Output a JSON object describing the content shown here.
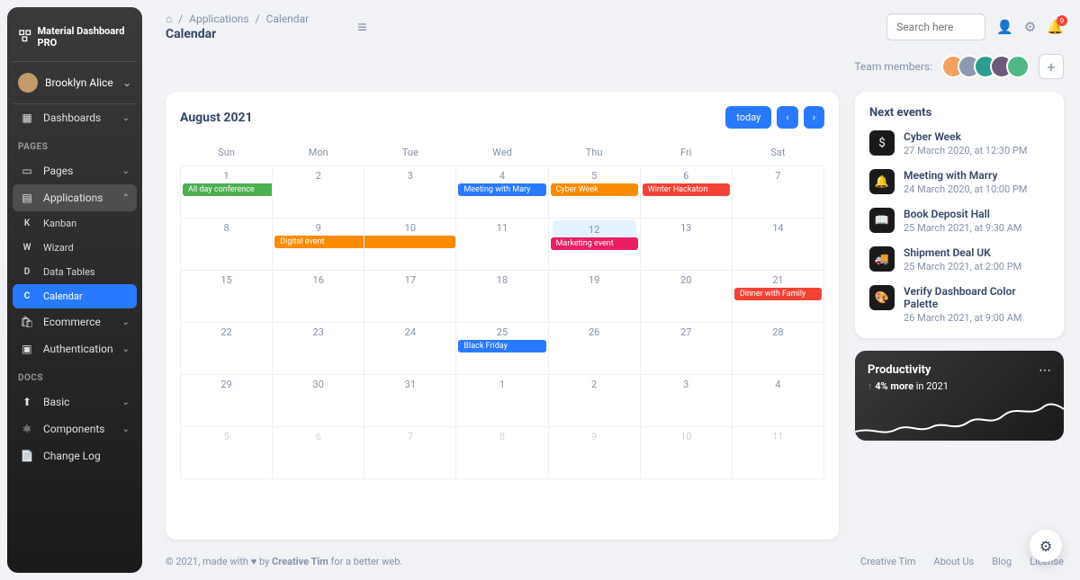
{
  "brand": "Material Dashboard PRO",
  "user": {
    "name": "Brooklyn Alice"
  },
  "sidebar": {
    "dashboards": "Dashboards",
    "section_pages": "PAGES",
    "pages": "Pages",
    "applications": "Applications",
    "sub": {
      "kanban": {
        "letter": "K",
        "label": "Kanban"
      },
      "wizard": {
        "letter": "W",
        "label": "Wizard"
      },
      "datatables": {
        "letter": "D",
        "label": "Data Tables"
      },
      "calendar": {
        "letter": "C",
        "label": "Calendar"
      }
    },
    "ecommerce": "Ecommerce",
    "authentication": "Authentication",
    "section_docs": "DOCS",
    "basic": "Basic",
    "components": "Components",
    "changelog": "Change Log"
  },
  "breadcrumb": {
    "home_icon": "⌂",
    "l1": "Applications",
    "l2": "Calendar"
  },
  "page_title": "Calendar",
  "search_placeholder": "Search here",
  "notif_count": "9",
  "team_label": "Team members:",
  "calendar": {
    "title": "August 2021",
    "today": "today",
    "days": [
      "Sun",
      "Mon",
      "Tue",
      "Wed",
      "Thu",
      "Fri",
      "Sat"
    ],
    "weeks": [
      [
        "1",
        "2",
        "3",
        "4",
        "5",
        "6",
        "7"
      ],
      [
        "8",
        "9",
        "10",
        "11",
        "12",
        "13",
        "14"
      ],
      [
        "15",
        "16",
        "17",
        "18",
        "19",
        "20",
        "21"
      ],
      [
        "22",
        "23",
        "24",
        "25",
        "26",
        "27",
        "28"
      ],
      [
        "29",
        "30",
        "31",
        "1",
        "2",
        "3",
        "4"
      ],
      [
        "5",
        "6",
        "7",
        "8",
        "9",
        "10",
        "11"
      ]
    ],
    "events": {
      "w0c0": {
        "label": "All day conference",
        "cls": "ev-green"
      },
      "w0c3": {
        "label": "Meeting with Mary",
        "cls": "ev-blue"
      },
      "w0c4a": {
        "label": "Cyber Week",
        "cls": "ev-orange"
      },
      "w0c4b": {
        "label": "Winter Hackaton",
        "cls": "ev-red"
      },
      "w1c1": {
        "label": "Digital event",
        "cls": "ev-orange"
      },
      "w1c4": {
        "label": "Marketing event",
        "cls": "ev-pink"
      },
      "w2c6": {
        "label": "Dinner with Family",
        "cls": "ev-red"
      },
      "w3c3": {
        "label": "Black Friday",
        "cls": "ev-blue"
      }
    }
  },
  "next_events": {
    "title": "Next events",
    "items": [
      {
        "icon": "$",
        "title": "Cyber Week",
        "date": "27 March 2020, at 12:30 PM"
      },
      {
        "icon": "🔔",
        "title": "Meeting with Marry",
        "date": "24 March 2020, at 10:00 PM"
      },
      {
        "icon": "📖",
        "title": "Book Deposit Hall",
        "date": "25 March 2021, at 9:30 AM"
      },
      {
        "icon": "🚚",
        "title": "Shipment Deal UK",
        "date": "25 March 2021, at 2:00 PM"
      },
      {
        "icon": "🎨",
        "title": "Verify Dashboard Color Palette",
        "date": "26 March 2021, at 9:00 AM"
      }
    ]
  },
  "productivity": {
    "title": "Productivity",
    "delta_arrow": "↑",
    "delta_text": "4% more",
    "delta_suffix": "in 2021"
  },
  "footer": {
    "text_pre": "© 2021, made with ",
    "heart": "♥",
    "text_mid": " by ",
    "brand": "Creative Tim",
    "text_post": " for a better web.",
    "links": [
      "Creative Tim",
      "About Us",
      "Blog",
      "License"
    ]
  }
}
